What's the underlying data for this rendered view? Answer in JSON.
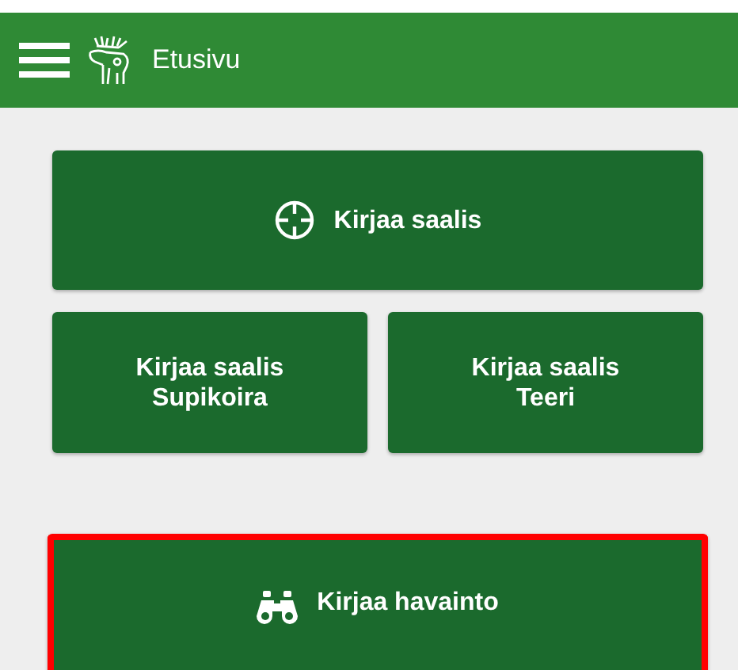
{
  "app_bar": {
    "title": "Etusivu"
  },
  "actions": [
    {
      "kind": "catch",
      "label": "Kirjaa saalis",
      "highlighted": false
    },
    {
      "kind": "half",
      "label": "Kirjaa saalis\nSupikoira",
      "highlighted": false
    },
    {
      "kind": "half",
      "label": "Kirjaa saalis\nTeeri",
      "highlighted": false
    },
    {
      "kind": "sighting",
      "label": "Kirjaa havainto",
      "highlighted": true
    }
  ]
}
